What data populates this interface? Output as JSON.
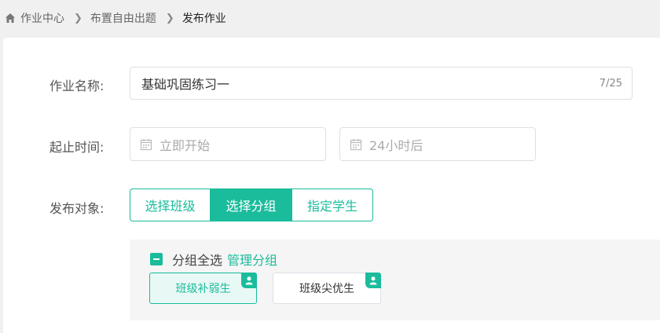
{
  "breadcrumb": {
    "items": [
      "作业中心",
      "布置自由出题"
    ],
    "current": "发布作业"
  },
  "form": {
    "name_label": "作业名称:",
    "name_value": "基础巩固练习一",
    "name_counter": "7/25",
    "time_label": "起止时间:",
    "start_placeholder": "立即开始",
    "end_placeholder": "24小时后",
    "target_label": "发布对象:",
    "target_options": [
      "选择班级",
      "选择分组",
      "指定学生"
    ],
    "target_selected": "选择分组"
  },
  "groups": {
    "select_all": "分组全选",
    "manage": "管理分组",
    "items": [
      "班级补弱生",
      "班级尖优生"
    ]
  },
  "colors": {
    "accent": "#1abc9c"
  }
}
